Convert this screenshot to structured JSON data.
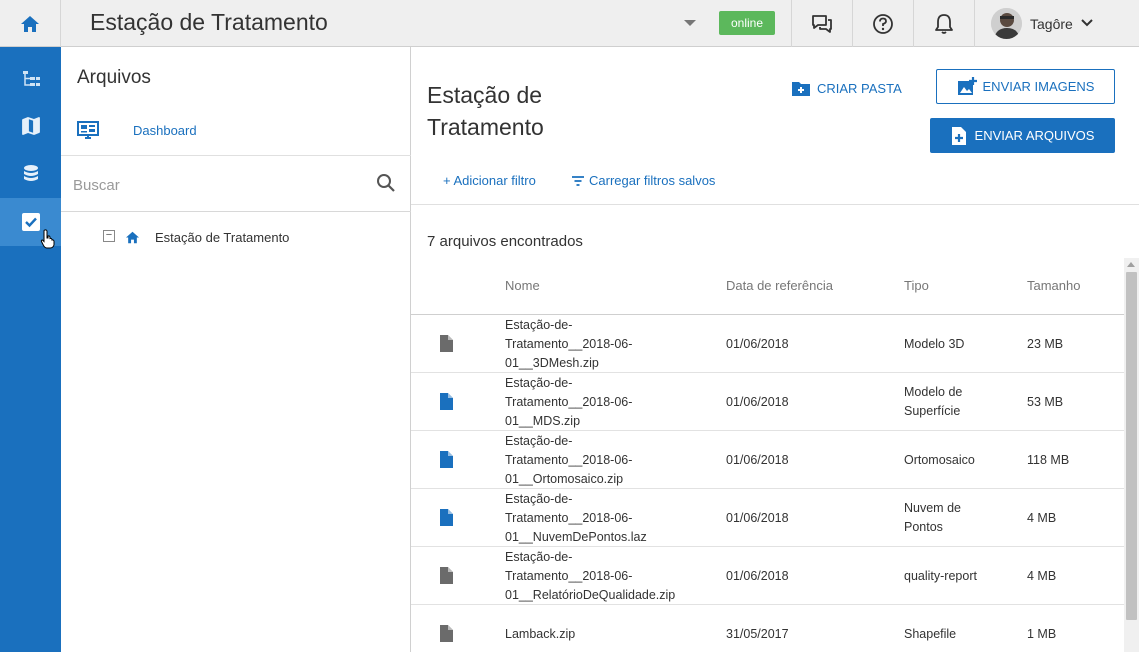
{
  "topbar": {
    "title": "Estação de Tratamento",
    "status": "online",
    "user_name": "Tagôre",
    "icons": [
      "home-icon",
      "chat-icon",
      "help-icon",
      "bell-icon",
      "chevron-down-icon"
    ]
  },
  "rail": {
    "items": [
      "tree-icon",
      "map-icon",
      "database-icon",
      "check-square-icon"
    ],
    "active_index": 3
  },
  "files_panel": {
    "title": "Arquivos",
    "dashboard_label": "Dashboard",
    "search_placeholder": "Buscar",
    "tree": [
      {
        "label": "Estação de Tratamento",
        "expanded": true
      }
    ]
  },
  "main": {
    "title": "Estação de Tratamento",
    "create_folder_label": "CRIAR PASTA",
    "send_images_label": "ENVIAR IMAGENS",
    "send_files_label": "ENVIAR ARQUIVOS",
    "add_filter_label": "+ Adicionar filtro",
    "load_filters_label": "Carregar filtros salvos",
    "count_text": "7 arquivos encontrados",
    "columns": {
      "name": "Nome",
      "date": "Data de referência",
      "type": "Tipo",
      "size": "Tamanho"
    },
    "rows": [
      {
        "name": "Estação-de-Tratamento__2018-06-01__3DMesh.zip",
        "date": "01/06/2018",
        "type": "Modelo 3D",
        "size": "23 MB",
        "icon_color": "#6b6b6b"
      },
      {
        "name": "Estação-de-Tratamento__2018-06-01__MDS.zip",
        "date": "01/06/2018",
        "type": "Modelo de Superfície",
        "size": "53 MB",
        "icon_color": "#1a70be"
      },
      {
        "name": "Estação-de-Tratamento__2018-06-01__Ortomosaico.zip",
        "date": "01/06/2018",
        "type": "Ortomosaico",
        "size": "118 MB",
        "icon_color": "#1a70be"
      },
      {
        "name": "Estação-de-Tratamento__2018-06-01__NuvemDePontos.laz",
        "date": "01/06/2018",
        "type": "Nuvem de Pontos",
        "size": "4 MB",
        "icon_color": "#1a70be"
      },
      {
        "name": "Estação-de-Tratamento__2018-06-01__RelatórioDeQualidade.zip",
        "date": "01/06/2018",
        "type": "quality-report",
        "size": "4 MB",
        "icon_color": "#6b6b6b"
      },
      {
        "name": "Lamback.zip",
        "date": "31/05/2017",
        "type": "Shapefile",
        "size": "1 MB",
        "icon_color": "#6b6b6b"
      }
    ]
  },
  "colors": {
    "brand": "#1a70be",
    "online": "#5cb85c",
    "rail_active": "#3a8ad0"
  }
}
